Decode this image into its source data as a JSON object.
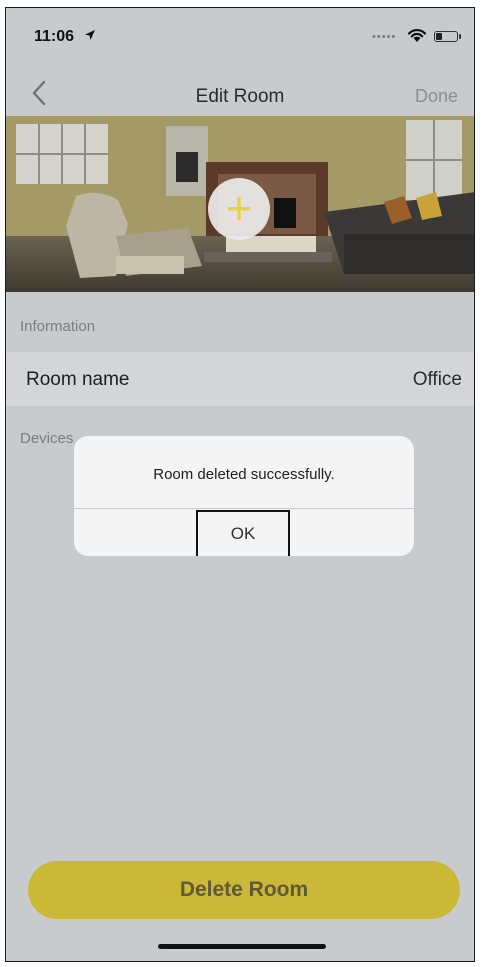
{
  "status": {
    "time": "11:06",
    "battery_level": 0.3
  },
  "nav": {
    "title": "Edit Room",
    "done_label": "Done"
  },
  "photo": {
    "add_label": "+"
  },
  "information": {
    "header": "Information",
    "room_name_label": "Room name",
    "room_name_value": "Office"
  },
  "devices": {
    "header": "Devices"
  },
  "alert": {
    "message": "Room deleted successfully.",
    "ok_label": "OK"
  },
  "actions": {
    "delete_label": "Delete Room"
  },
  "colors": {
    "accent_yellow": "#e7d340",
    "delete_button": "#cbb836",
    "backdrop": "#c8cbce",
    "alert_bg": "#f4f4f5"
  }
}
